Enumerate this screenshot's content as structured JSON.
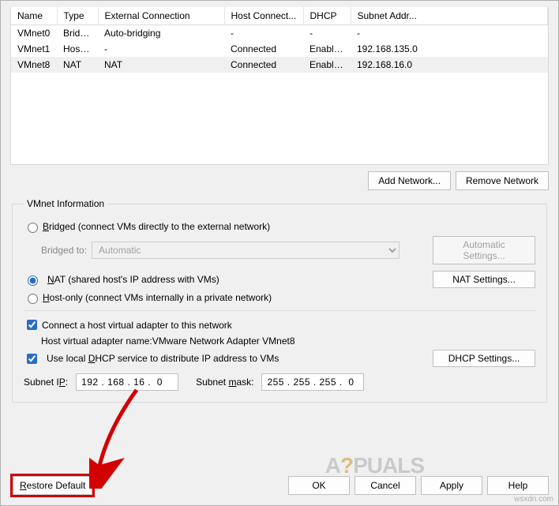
{
  "table": {
    "headers": {
      "name": "Name",
      "type": "Type",
      "ext": "External Connection",
      "host": "Host Connect...",
      "dhcp": "DHCP",
      "subnet": "Subnet Addr..."
    },
    "rows": [
      {
        "name": "VMnet0",
        "type": "Bridged",
        "ext": "Auto-bridging",
        "host": "-",
        "dhcp": "-",
        "subnet": "-"
      },
      {
        "name": "VMnet1",
        "type": "Host-...",
        "ext": "-",
        "host": "Connected",
        "dhcp": "Enabled",
        "subnet": "192.168.135.0"
      },
      {
        "name": "VMnet8",
        "type": "NAT",
        "ext": "NAT",
        "host": "Connected",
        "dhcp": "Enabled",
        "subnet": "192.168.16.0"
      }
    ]
  },
  "buttons": {
    "add_network": "Add Network...",
    "remove_network": "Remove Network",
    "automatic_settings": "Automatic Settings...",
    "nat_settings": "NAT Settings...",
    "dhcp_settings": "DHCP Settings...",
    "restore_default": "Restore Default",
    "ok": "OK",
    "cancel": "Cancel",
    "apply": "Apply",
    "help": "Help"
  },
  "group": {
    "legend": "VMnet Information",
    "bridged_label_pre": "B",
    "bridged_label_post": "ridged (connect VMs directly to the external network)",
    "bridged_to_label": "Bridged to:",
    "bridged_to_value": "Automatic",
    "nat_label_pre": "N",
    "nat_label_post": "AT (shared host's IP address with VMs)",
    "hostonly_label_pre": "H",
    "hostonly_label_post": "ost-only (connect VMs internally in a private network)",
    "host_adapter_label": "Connect a host virtual adapter to this network",
    "host_adapter_name_label": "Host virtual adapter name: ",
    "host_adapter_name_value": "VMware Network Adapter VMnet8",
    "dhcp_label_pre": "Use local ",
    "dhcp_label_u": "D",
    "dhcp_label_post": "HCP service to distribute IP address to VMs",
    "subnet_ip_label_pre": "Subnet I",
    "subnet_ip_label_u": "P",
    "subnet_ip_label_post": ":",
    "subnet_ip_value": "192 . 168 . 16 .  0",
    "subnet_mask_label_pre": "Subnet ",
    "subnet_mask_label_u": "m",
    "subnet_mask_label_post": "ask:",
    "subnet_mask_value": "255 . 255 . 255 .  0"
  },
  "watermark": {
    "pre": "A",
    "mid": "?",
    "post": "PUALS"
  },
  "credit": "wsxdn.com"
}
